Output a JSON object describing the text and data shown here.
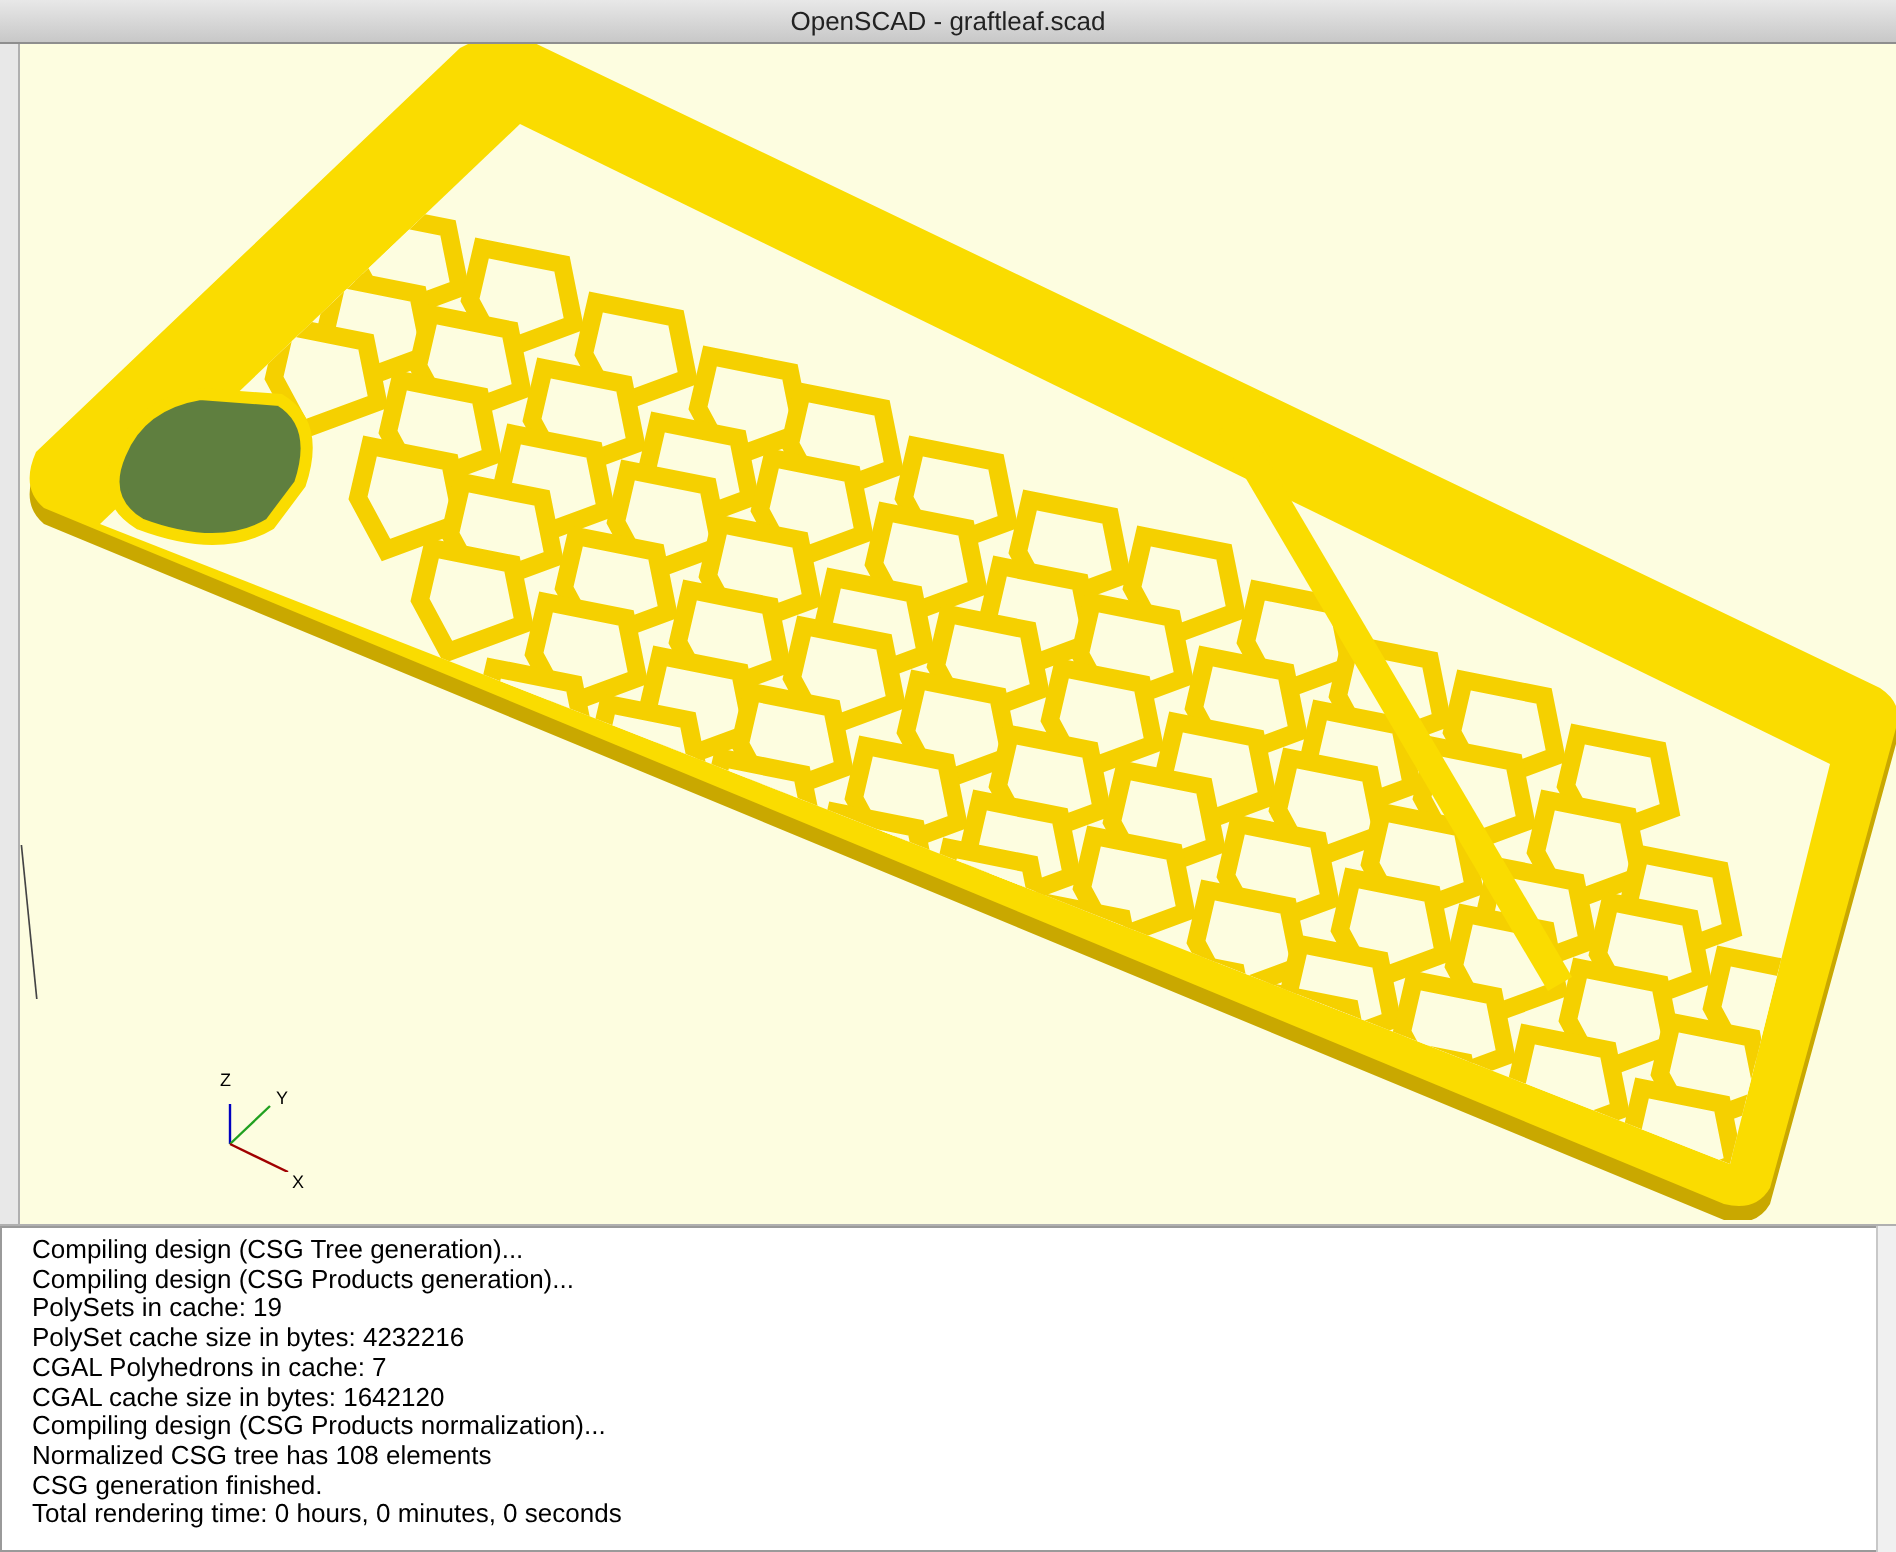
{
  "window": {
    "title": "OpenSCAD - graftleaf.scad"
  },
  "viewport": {
    "axes": [
      "X",
      "Y",
      "Z"
    ]
  },
  "console": {
    "lines": [
      "Compiling design (CSG Tree generation)...",
      "Compiling design (CSG Products generation)...",
      "PolySets in cache: 19",
      "PolySet cache size in bytes: 4232216",
      "CGAL Polyhedrons in cache: 7",
      "CGAL cache size in bytes: 1642120",
      "Compiling design (CSG Products normalization)...",
      "Normalized CSG tree has 108 elements",
      "CSG generation finished.",
      "Total rendering time: 0 hours, 0 minutes, 0 seconds"
    ]
  }
}
